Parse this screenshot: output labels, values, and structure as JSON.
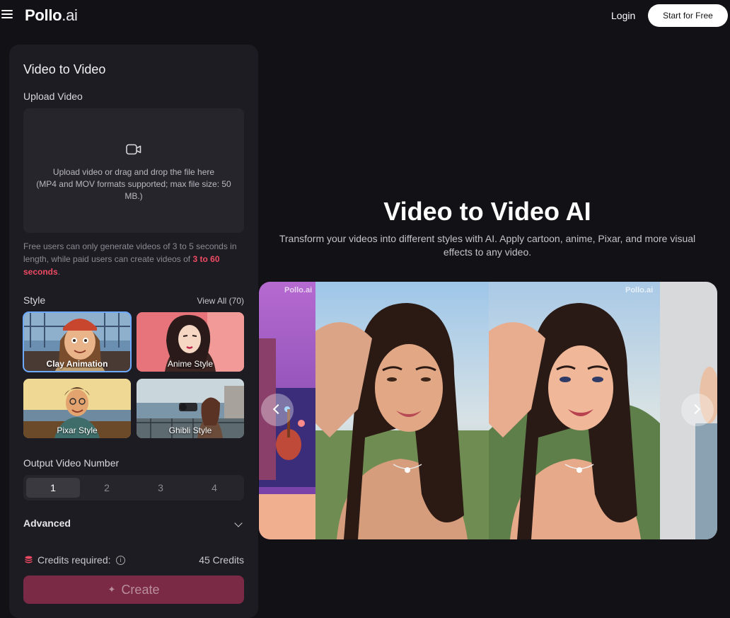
{
  "header": {
    "logo_main": "Pollo",
    "logo_suffix": ".ai",
    "login": "Login",
    "start": "Start for Free"
  },
  "panel": {
    "title": "Video to Video",
    "upload_label": "Upload Video",
    "drop_line1": "Upload video or drag and drop the file here",
    "drop_line2": "(MP4 and MOV formats supported; max file size: 50 MB.)",
    "note_before": "Free users can only generate videos of 3 to 5 seconds in length, while paid users can create videos of ",
    "note_highlight": "3 to 60 seconds",
    "note_after": ".",
    "style_label": "Style",
    "view_all": "View All (70)",
    "styles": [
      {
        "name": "Clay Animation",
        "selected": true
      },
      {
        "name": "Anime Style",
        "selected": false
      },
      {
        "name": "Pixar Style",
        "selected": false
      },
      {
        "name": "Ghibli Style",
        "selected": false
      }
    ],
    "output_label": "Output Video Number",
    "output_options": [
      "1",
      "2",
      "3",
      "4"
    ],
    "output_selected": "1",
    "advanced": "Advanced",
    "credits_label": "Credits required:",
    "credits_value": "45 Credits",
    "create": "Create"
  },
  "hero": {
    "title": "Video to Video AI",
    "subtitle": "Transform your videos into different styles with AI. Apply cartoon, anime, Pixar, and more visual effects to any video."
  },
  "carousel": {
    "watermark_main": "Pollo",
    "watermark_suffix": ".ai"
  },
  "colors": {
    "accent": "#ef4a63",
    "create_bg": "#7b2a45",
    "selection": "#6da9ff"
  }
}
